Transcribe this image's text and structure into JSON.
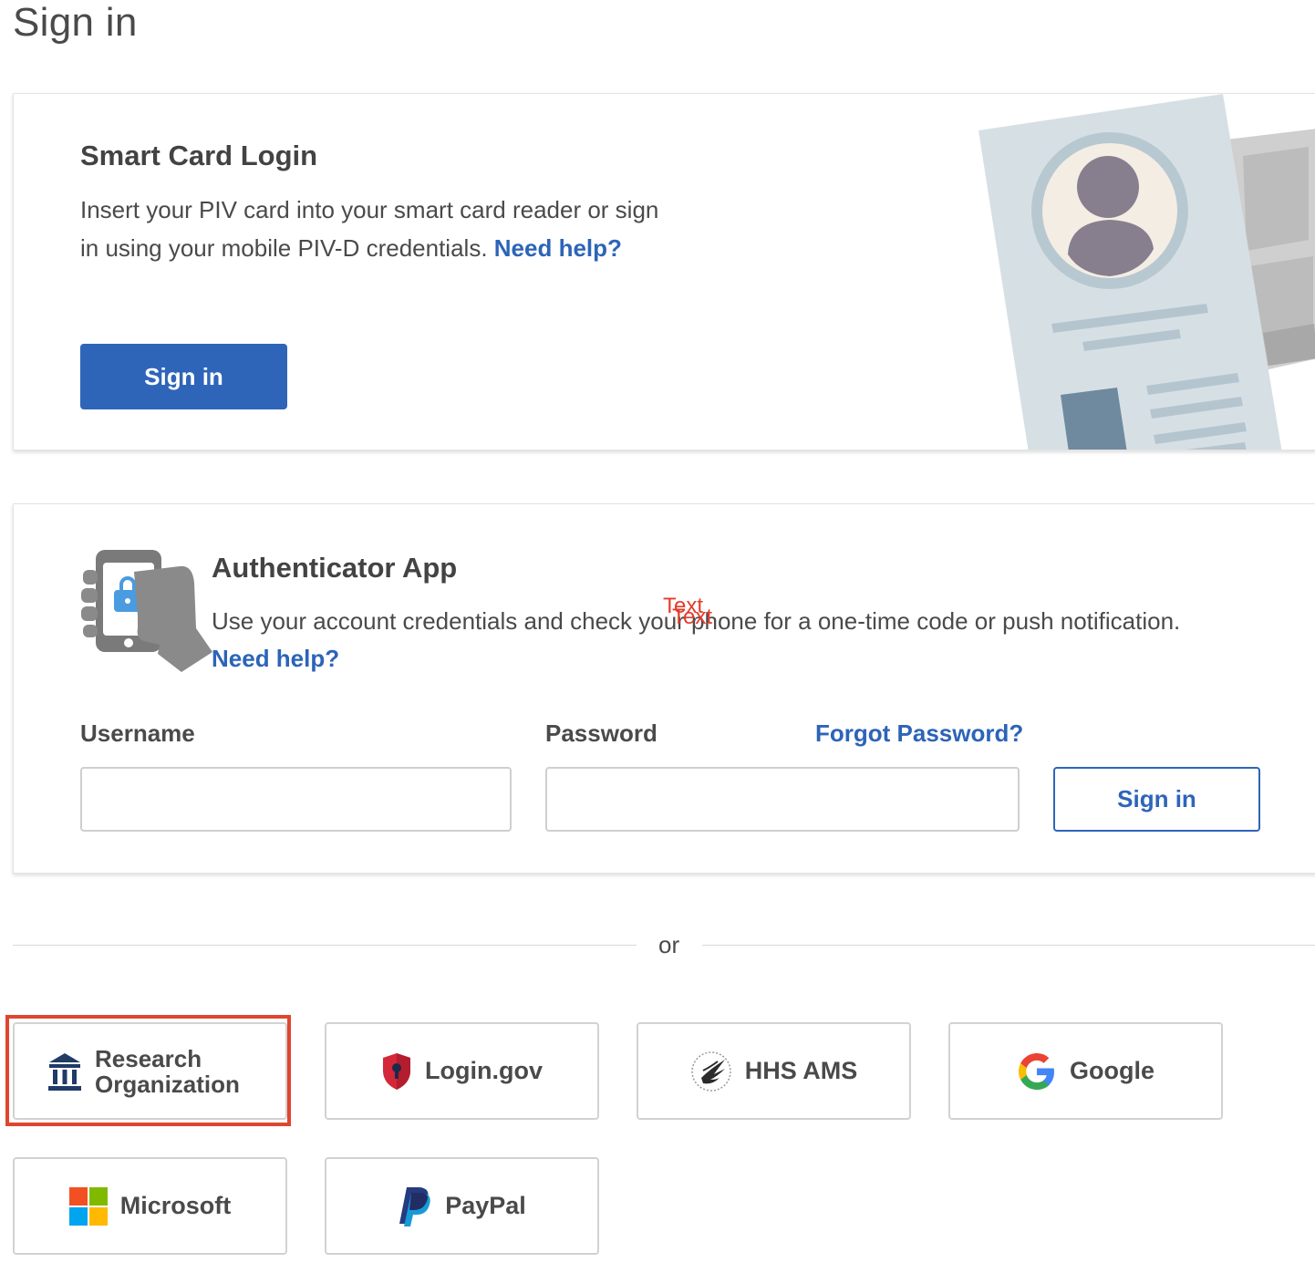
{
  "page": {
    "title": "Sign in"
  },
  "smart_card": {
    "heading": "Smart Card Login",
    "text": "Insert your PIV card into your smart card reader or sign in using your mobile PIV-D credentials.",
    "help_link": "Need help?",
    "button": "Sign in",
    "illustration_icon": "id-card-illustration-icon"
  },
  "authenticator": {
    "heading": "Authenticator App",
    "text": "Use your account credentials and check your phone for a one-time code or push notification.",
    "help_link": "Need help?",
    "overlay_text_1": "Text",
    "overlay_text_2": "Text",
    "username_label": "Username",
    "password_label": "Password",
    "forgot_link": "Forgot Password?",
    "username_value": "",
    "password_value": "",
    "button": "Sign in",
    "icon": "phone-in-hand-lock-icon"
  },
  "divider": {
    "text": "or"
  },
  "providers": [
    {
      "label_line1": "Research",
      "label_line2": "Organization",
      "icon": "institution-icon",
      "highlighted": true
    },
    {
      "label": "Login.gov",
      "icon": "shield-keyhole-icon"
    },
    {
      "label": "HHS AMS",
      "icon": "hhs-eagle-icon"
    },
    {
      "label": "Google",
      "icon": "google-g-icon"
    },
    {
      "label": "Microsoft",
      "icon": "microsoft-logo-icon"
    },
    {
      "label": "PayPal",
      "icon": "paypal-logo-icon"
    }
  ],
  "colors": {
    "primary": "#2e65b9",
    "link": "#2c64b8",
    "highlight": "#e0452f",
    "overlay_text": "#e53b2b"
  }
}
